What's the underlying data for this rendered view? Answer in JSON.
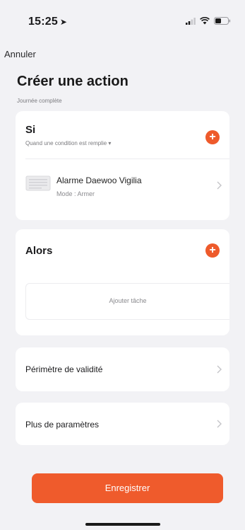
{
  "status_bar": {
    "time": "15:25",
    "location_arrow": "location-arrow-icon"
  },
  "nav": {
    "cancel_label": "Annuler"
  },
  "header": {
    "title": "Créer une action",
    "subtitle": "Journée complète"
  },
  "si_section": {
    "title": "Si",
    "condition_label": "Quand une condition est remplie",
    "condition_caret": "▾",
    "add_icon": "plus-icon",
    "device": {
      "name": "Alarme Daewoo Vigilia",
      "mode": "Mode : Armer"
    }
  },
  "alors_section": {
    "title": "Alors",
    "add_icon": "plus-icon",
    "add_task_label": "Ajouter tâche"
  },
  "settings": {
    "perimetre_label": "Périmètre de validité",
    "params_label": "Plus de paramètres"
  },
  "footer": {
    "save_label": "Enregistrer"
  },
  "colors": {
    "accent": "#ef5b2c",
    "background": "#f2f2f5",
    "card": "#ffffff"
  }
}
